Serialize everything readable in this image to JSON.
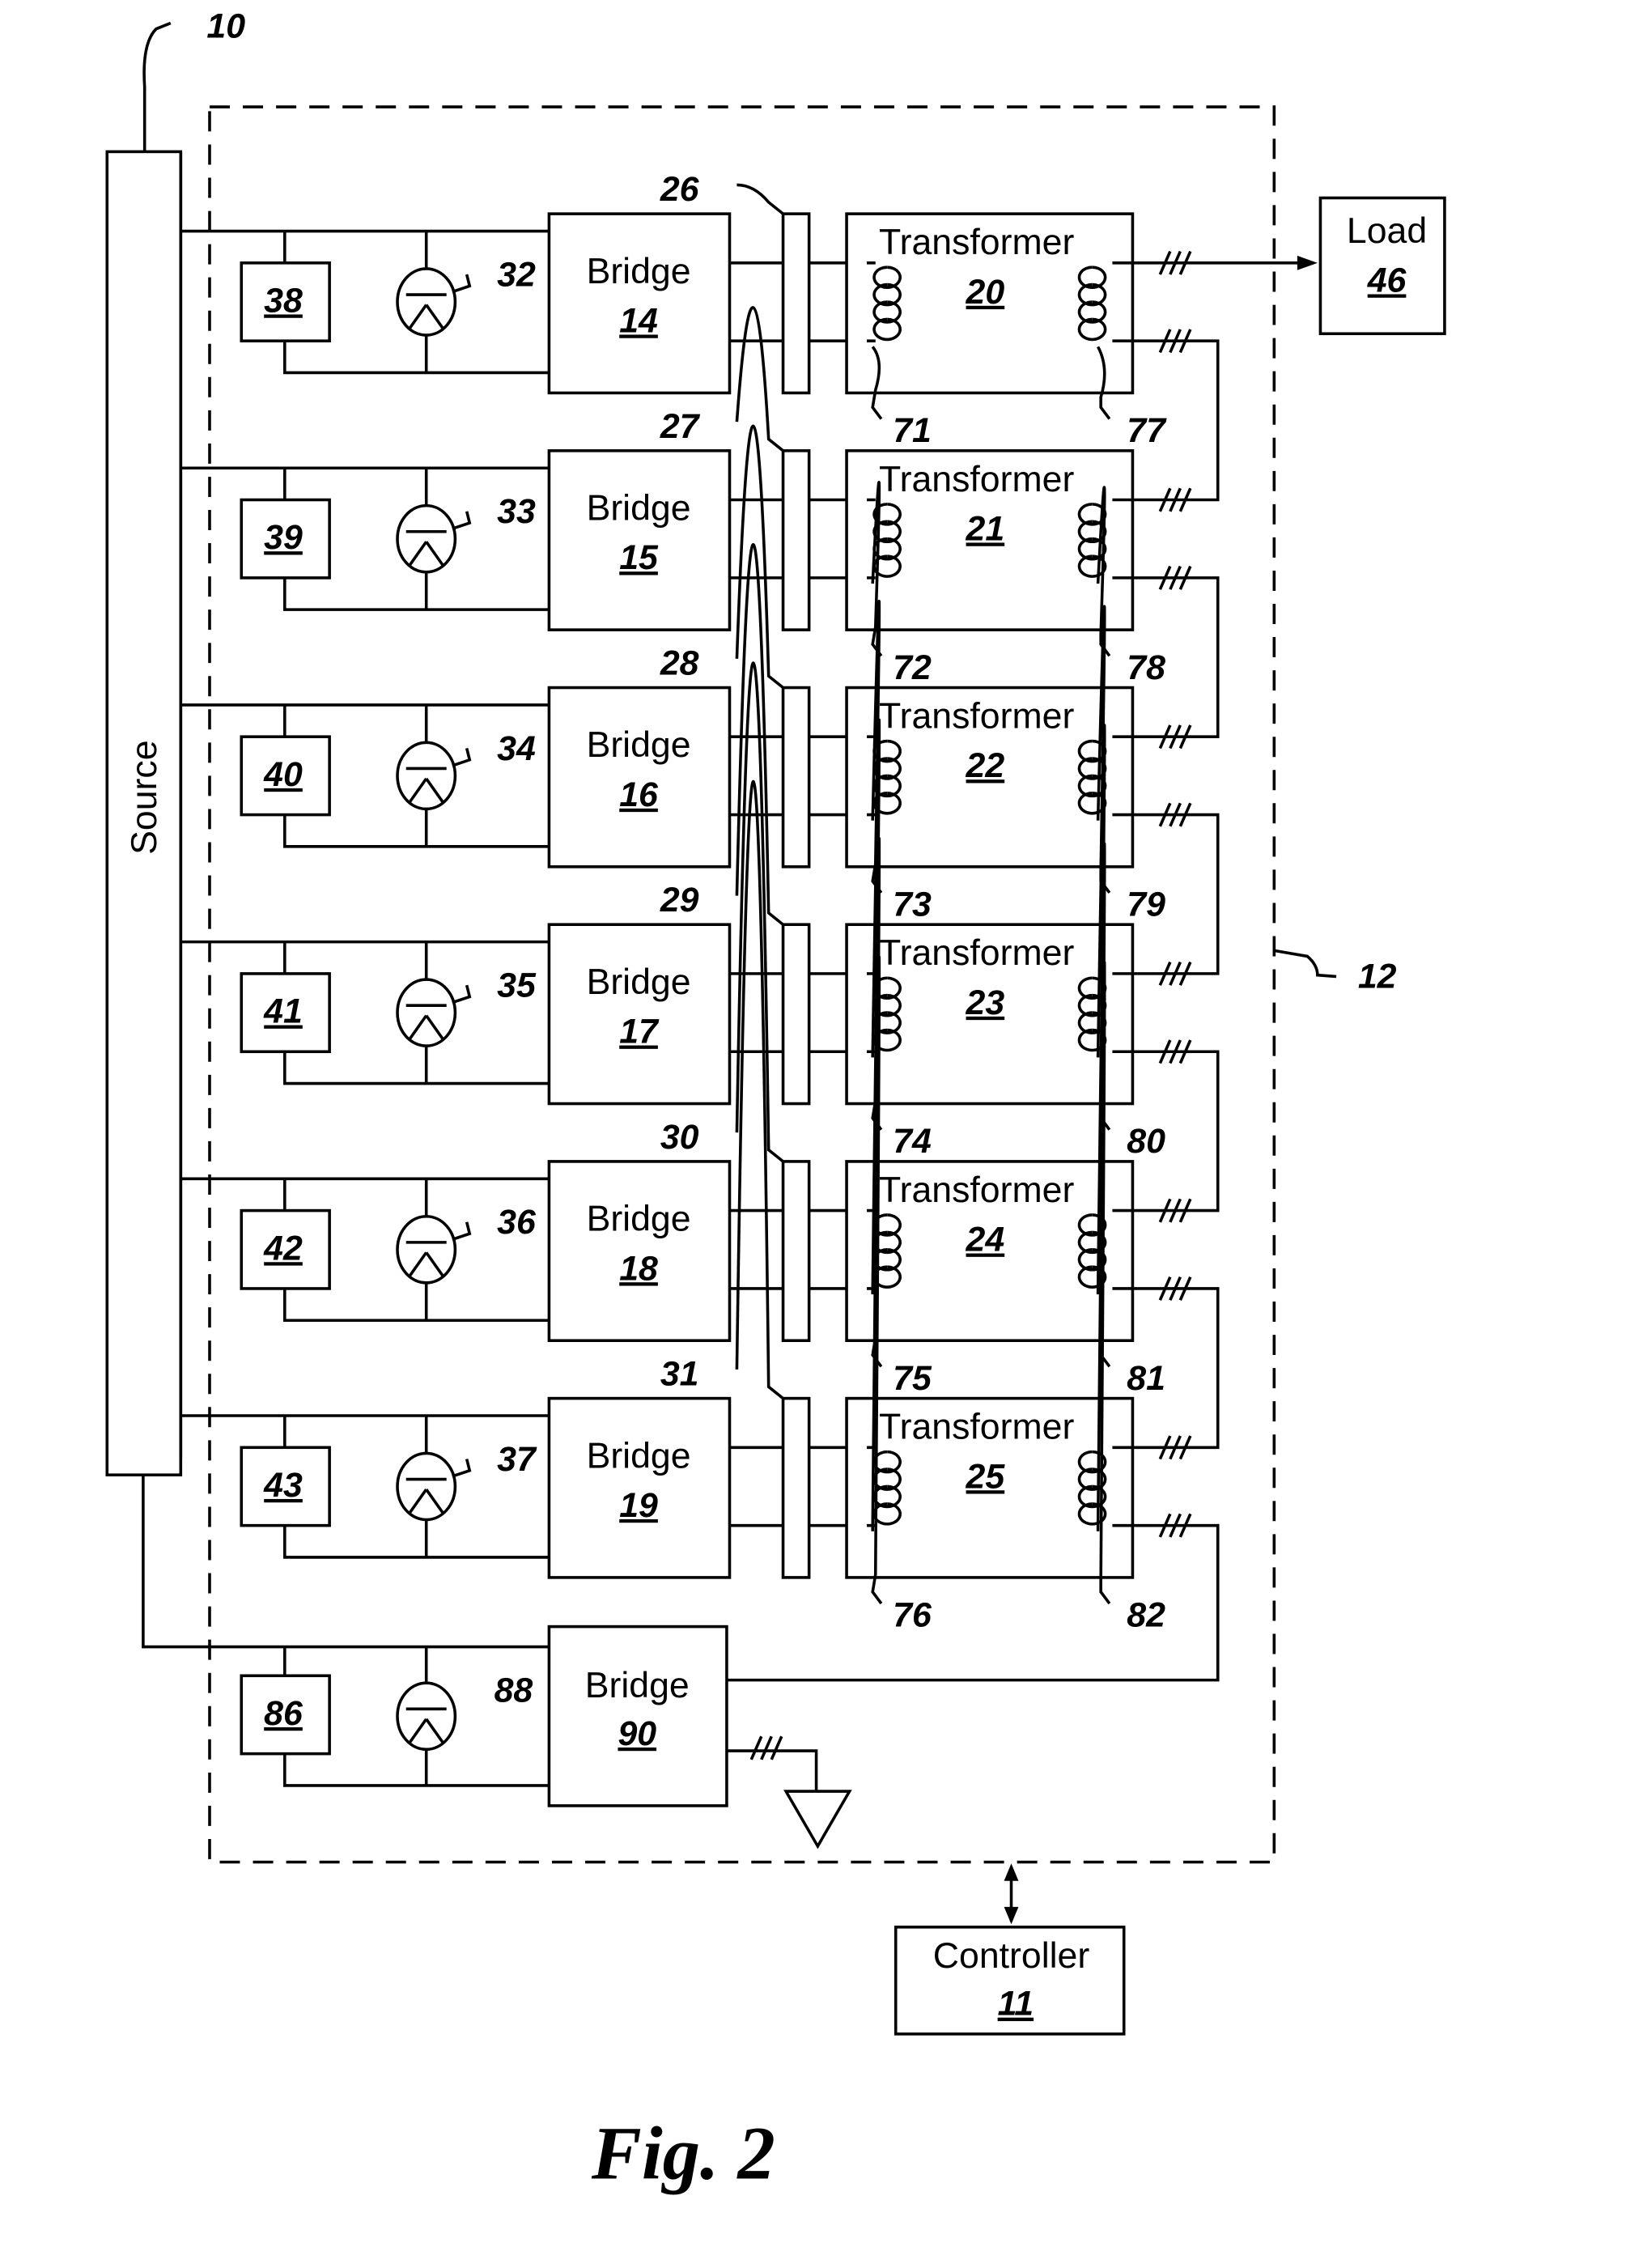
{
  "figure": {
    "caption": "Fig. 2",
    "system_ref": "10",
    "enclosure_ref": "12"
  },
  "source": {
    "label": "Source"
  },
  "load": {
    "label": "Load",
    "ref": "46"
  },
  "controller": {
    "label": "Controller",
    "ref": "11"
  },
  "stages": [
    {
      "box_ref": "38",
      "cap_ref": "32",
      "bridge_label": "Bridge",
      "bridge_ref": "14",
      "link_ref": "26",
      "transformer_label": "Transformer",
      "transformer_ref": "20",
      "primary_ref": "71",
      "secondary_ref": "77"
    },
    {
      "box_ref": "39",
      "cap_ref": "33",
      "bridge_label": "Bridge",
      "bridge_ref": "15",
      "link_ref": "27",
      "transformer_label": "Transformer",
      "transformer_ref": "21",
      "primary_ref": "72",
      "secondary_ref": "78"
    },
    {
      "box_ref": "40",
      "cap_ref": "34",
      "bridge_label": "Bridge",
      "bridge_ref": "16",
      "link_ref": "28",
      "transformer_label": "Transformer",
      "transformer_ref": "22",
      "primary_ref": "73",
      "secondary_ref": "79"
    },
    {
      "box_ref": "41",
      "cap_ref": "35",
      "bridge_label": "Bridge",
      "bridge_ref": "17",
      "link_ref": "29",
      "transformer_label": "Transformer",
      "transformer_ref": "23",
      "primary_ref": "74",
      "secondary_ref": "80"
    },
    {
      "box_ref": "42",
      "cap_ref": "36",
      "bridge_label": "Bridge",
      "bridge_ref": "18",
      "link_ref": "30",
      "transformer_label": "Transformer",
      "transformer_ref": "24",
      "primary_ref": "75",
      "secondary_ref": "81"
    },
    {
      "box_ref": "43",
      "cap_ref": "37",
      "bridge_label": "Bridge",
      "bridge_ref": "19",
      "link_ref": "31",
      "transformer_label": "Transformer",
      "transformer_ref": "25",
      "primary_ref": "76",
      "secondary_ref": "82"
    }
  ],
  "neutral_stage": {
    "box_ref": "86",
    "cap_ref": "88",
    "bridge_label": "Bridge",
    "bridge_ref": "90"
  }
}
